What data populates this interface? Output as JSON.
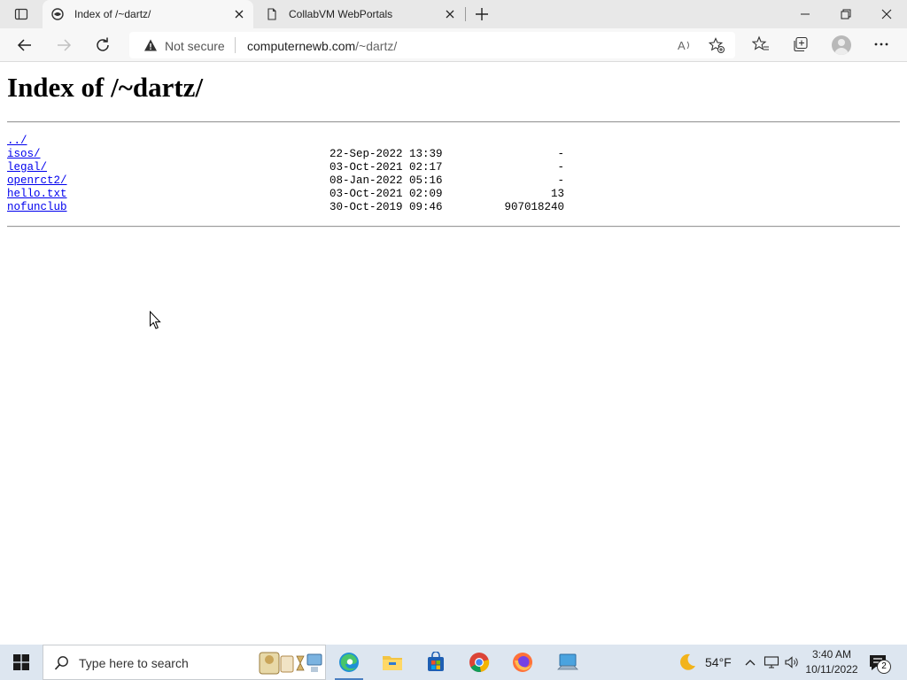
{
  "browser": {
    "tabs": [
      {
        "title": "Index of /~dartz/",
        "active": true
      },
      {
        "title": "CollabVM WebPortals",
        "active": false
      }
    ],
    "address_bar": {
      "security_label": "Not secure",
      "url_host": "computernewb.com",
      "url_path": "/~dartz/"
    }
  },
  "page": {
    "heading": "Index of /~dartz/",
    "entries": [
      {
        "name": "../",
        "date": "",
        "size": ""
      },
      {
        "name": "isos/",
        "date": "22-Sep-2022 13:39",
        "size": "-"
      },
      {
        "name": "legal/",
        "date": "03-Oct-2021 02:17",
        "size": "-"
      },
      {
        "name": "openrct2/",
        "date": "08-Jan-2022 05:16",
        "size": "-"
      },
      {
        "name": "hello.txt",
        "date": "03-Oct-2021 02:09",
        "size": "13"
      },
      {
        "name": "nofunclub",
        "date": "30-Oct-2019 09:46",
        "size": "907018240"
      }
    ]
  },
  "taskbar": {
    "search_placeholder": "Type here to search",
    "weather": {
      "temperature": "54°F",
      "icon": "moon-icon"
    },
    "clock": {
      "time": "3:40 AM",
      "date": "10/11/2022"
    },
    "notification_count": "2",
    "pinned_apps": [
      "edge-icon",
      "file-explorer-icon",
      "microsoft-store-icon",
      "chrome-icon",
      "firefox-icon",
      "computer-icon"
    ]
  },
  "colors": {
    "link": "#0000ee",
    "taskbar_bg": "#dde6f0",
    "tabstrip_bg": "#e8e8e8"
  }
}
